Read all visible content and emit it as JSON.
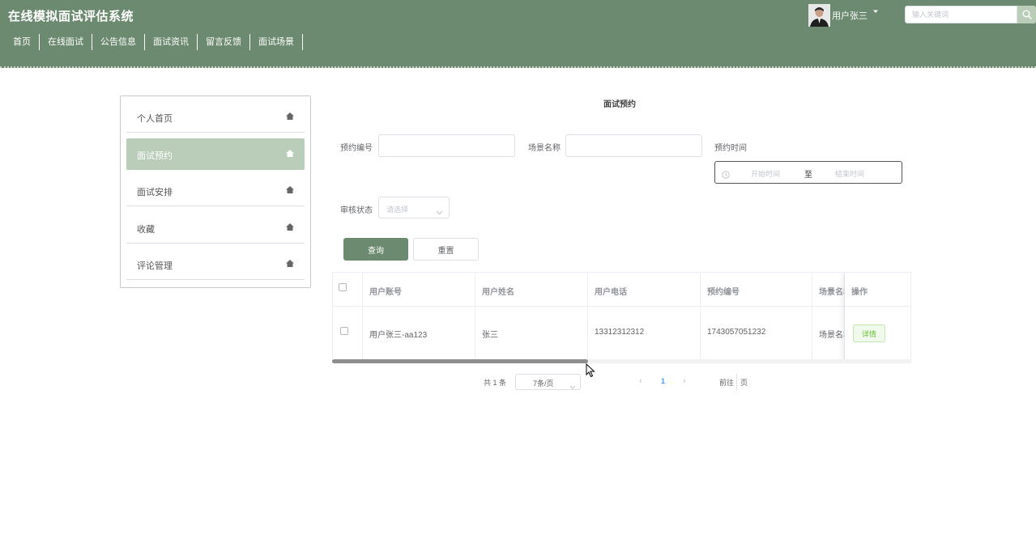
{
  "header": {
    "title": "在线模拟面试评估系统",
    "nav": [
      "首页",
      "在线面试",
      "公告信息",
      "面试资讯",
      "留言反馈",
      "面试场景"
    ],
    "user_name": "用户张三",
    "search_placeholder": "输入关键词"
  },
  "sidebar": {
    "items": [
      {
        "label": "个人首页",
        "active": false
      },
      {
        "label": "面试预约",
        "active": true
      },
      {
        "label": "面试安排",
        "active": false
      },
      {
        "label": "收藏",
        "active": false
      },
      {
        "label": "评论管理",
        "active": false
      }
    ]
  },
  "main": {
    "title": "面试预约",
    "filters": {
      "reservation_no_label": "预约编号",
      "reservation_no_value": "",
      "scene_name_label": "场景名称",
      "scene_name_value": "",
      "reservation_time_label": "预约时间",
      "start_placeholder": "开始时间",
      "range_separator": "至",
      "end_placeholder": "结束时间",
      "audit_status_label": "审核状态",
      "audit_status_placeholder": "请选择"
    },
    "buttons": {
      "query": "查询",
      "reset": "重置"
    },
    "table": {
      "columns": [
        "用户账号",
        "用户姓名",
        "用户电话",
        "预约编号",
        "场景名称"
      ],
      "op_header": "操作",
      "rows": [
        {
          "account": "用户张三-aa123",
          "name": "张三",
          "phone": "13312312312",
          "reservation_no": "1743057051232",
          "scene": "场景名称",
          "action": "详情"
        }
      ]
    },
    "pagination": {
      "total": "共 1 条",
      "page_size": "7条/页",
      "current_page": "1",
      "goto_label": "前往",
      "goto_suffix": "页"
    }
  },
  "colors": {
    "header_bg": "#6b8a6f",
    "accent_light": "#b9cdb9",
    "primary_button": "#6b8a6f",
    "detail_button_text": "#67c23a",
    "page_active": "#409eff"
  },
  "icons": {
    "sidebar_item": "home-icon",
    "search": "search-icon",
    "clock": "clock-icon",
    "select": "chevron-down-icon",
    "user_menu": "caret-down-icon",
    "cursor": "mouse-pointer-icon"
  }
}
